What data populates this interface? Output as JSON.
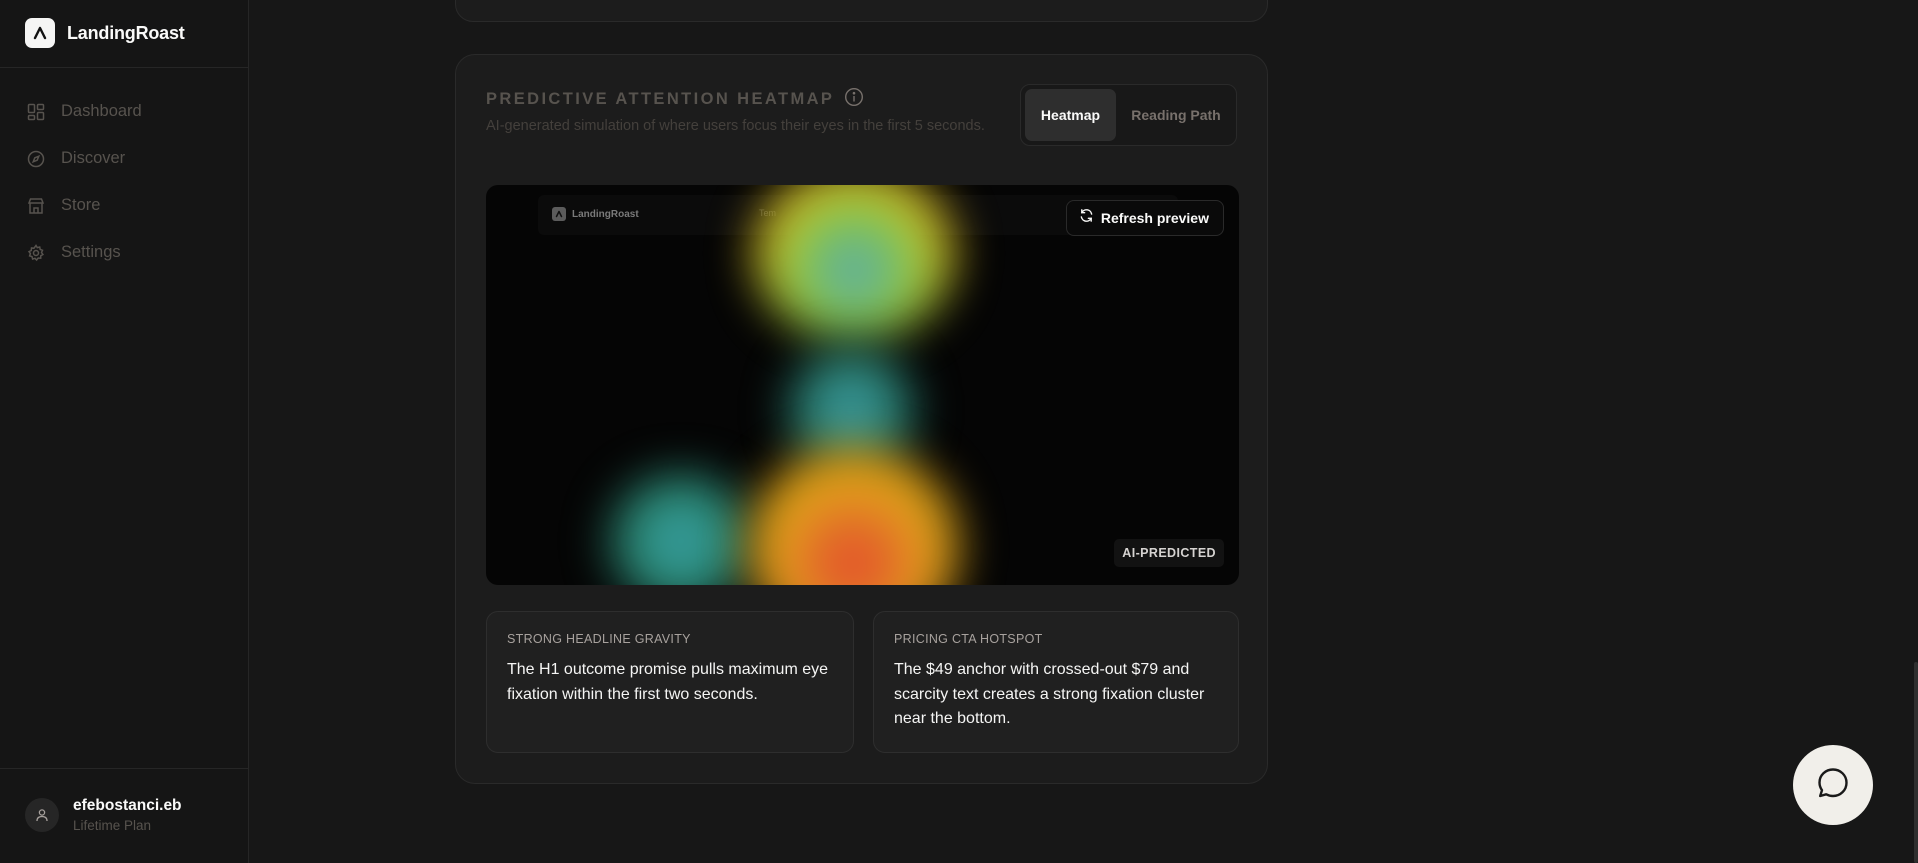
{
  "app": {
    "name": "LandingRoast"
  },
  "sidebar": {
    "items": [
      {
        "label": "Dashboard",
        "icon": "dashboard-icon"
      },
      {
        "label": "Discover",
        "icon": "compass-icon"
      },
      {
        "label": "Store",
        "icon": "store-icon"
      },
      {
        "label": "Settings",
        "icon": "gear-icon"
      }
    ],
    "user": {
      "name": "efebostanci.eb",
      "plan": "Lifetime Plan"
    }
  },
  "heatmap_card": {
    "title": "PREDICTIVE ATTENTION HEATMAP",
    "subtitle": "AI-generated simulation of where users focus their eyes in the first 5 seconds.",
    "toggle": {
      "active": "Heatmap",
      "inactive": "Reading Path"
    },
    "preview": {
      "brand": "LandingRoast",
      "nav_text": "Tem",
      "refresh_label": "Refresh preview",
      "badge": "AI-PREDICTED"
    },
    "insights": [
      {
        "label": "STRONG HEADLINE GRAVITY",
        "text": "The H1 outcome promise pulls maximum eye fixation within the first two seconds."
      },
      {
        "label": "PRICING CTA HOTSPOT",
        "text": "The $49 anchor with crossed-out $79 and scarcity text creates a strong fixation cluster near the bottom."
      }
    ]
  },
  "colors": {
    "background": "#171717",
    "card": "#1c1c1c",
    "heat_hot": "#e0442a",
    "heat_warm": "#e8b417",
    "heat_mid": "#7cc142",
    "heat_cool": "#2f8f96"
  }
}
